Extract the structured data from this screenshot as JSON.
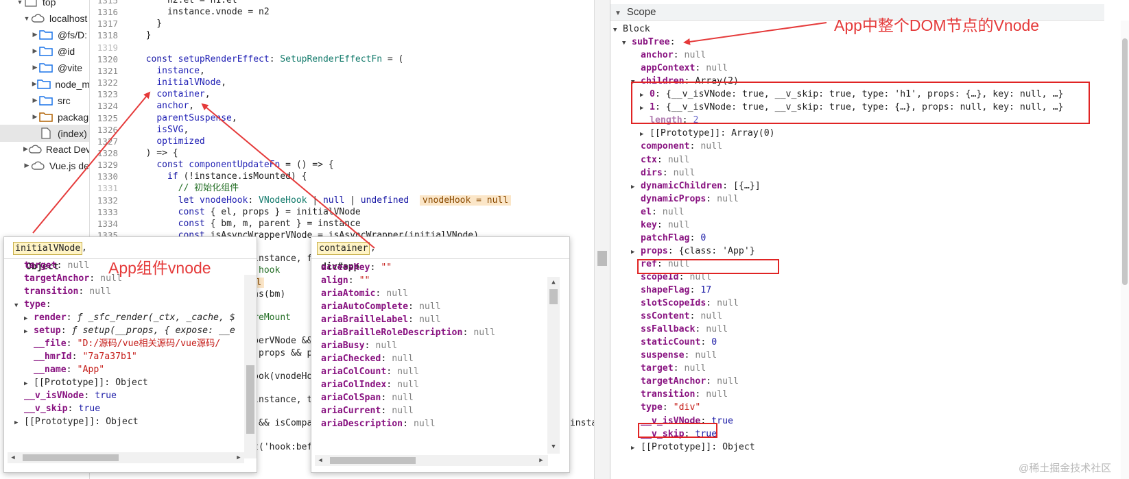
{
  "file_tree": {
    "items": [
      {
        "label": "top",
        "icon": "frame-icon",
        "arrow": "▼",
        "indent": 0
      },
      {
        "label": "localhost",
        "icon": "cloud-icon",
        "arrow": "▼",
        "indent": 1
      },
      {
        "label": "@fs/D:",
        "icon": "folder-icon",
        "arrow": "▶",
        "indent": 2
      },
      {
        "label": "@id",
        "icon": "folder-icon",
        "arrow": "▶",
        "indent": 2
      },
      {
        "label": "@vite",
        "icon": "folder-icon",
        "arrow": "▶",
        "indent": 2
      },
      {
        "label": "node_m",
        "icon": "folder-icon",
        "arrow": "▶",
        "indent": 2
      },
      {
        "label": "src",
        "icon": "folder-icon",
        "arrow": "▶",
        "indent": 2
      },
      {
        "label": "packag",
        "icon": "folder-orange-icon",
        "arrow": "▶",
        "indent": 2
      },
      {
        "label": "(index)",
        "icon": "file-icon",
        "arrow": "",
        "indent": 2
      },
      {
        "label": "React Dev",
        "icon": "cloud-icon",
        "arrow": "▶",
        "indent": 1
      },
      {
        "label": "Vue.js de",
        "icon": "cloud-icon",
        "arrow": "▶",
        "indent": 1
      }
    ]
  },
  "editor": {
    "lines": [
      {
        "n": "1315",
        "html": "      n2.el = n1.el"
      },
      {
        "n": "1316",
        "html": "      instance.vnode = n2"
      },
      {
        "n": "1317",
        "html": "    }"
      },
      {
        "n": "1318",
        "html": "  }"
      },
      {
        "n": "1319",
        "html": ""
      },
      {
        "n": "1320",
        "html": "  <span class='kw'>const</span> <span class='id'>setupRenderEffect</span>: <span class='ty'>SetupRenderEffectFn</span> = ("
      },
      {
        "n": "1321",
        "html": "    <span class='id'>instance</span>,"
      },
      {
        "n": "1322",
        "html": "    <span class='id'>initialVNode</span>,"
      },
      {
        "n": "1323",
        "html": "    <span class='id'>container</span>,"
      },
      {
        "n": "1324",
        "html": "    <span class='id'>anchor</span>,"
      },
      {
        "n": "1325",
        "html": "    <span class='id'>parentSuspense</span>,"
      },
      {
        "n": "1326",
        "html": "    <span class='id'>isSVG</span>,"
      },
      {
        "n": "1327",
        "html": "    <span class='id'>optimized</span>"
      },
      {
        "n": "1328",
        "html": "  ) => {"
      },
      {
        "n": "1329",
        "html": "    <span class='kw'>const</span> <span class='id'>componentUpdateFn</span> = () => {"
      },
      {
        "n": "1330",
        "html": "      <span class='kw'>if</span> (!instance.isMounted) {"
      },
      {
        "n": "1331",
        "html": "        <span class='cm'>// 初始化组件</span>"
      },
      {
        "n": "1332",
        "html": "        <span class='kw'>let</span> <span class='id'>vnodeHook</span>: <span class='ty'>VNodeHook</span> | <span class='kw'>null</span> | <span class='kw'>undefined</span>  <span class='hl'>vnodeHook = null</span>"
      },
      {
        "n": "1333",
        "html": "        <span class='kw'>const</span> { el, props } = initialVNode"
      },
      {
        "n": "1334",
        "html": "        <span class='kw'>const</span> { bm, m, parent } = instance"
      },
      {
        "n": "1335",
        "html": "        <span class='kw'>const</span> isAsyncWrapperVNode = isAsyncWrapper(initialVNode)"
      },
      {
        "n": "1336",
        "html": ""
      },
      {
        "n": "1337",
        "html": "        toggleRecurse(instance, false)"
      },
      {
        "n": "1338",
        "html": "        <span class='cm'>// beforeMount hook</span>"
      },
      {
        "n": "1339",
        "html": "        <span class='kw'>if</span> (bm) {  <span class='hl'>null</span>"
      },
      {
        "n": "1340",
        "html": "          invokeArrayFns(bm)"
      },
      {
        "n": "1341",
        "html": "        }"
      },
      {
        "n": "1342",
        "html": "        <span class='cm'>// onVnodeBeforeMount</span>"
      },
      {
        "n": "1343",
        "html": "        <span class='kw'>if</span> ("
      },
      {
        "n": "1344",
        "html": "          !isAsyncWrapperVNode &&"
      },
      {
        "n": "1345",
        "html": "          (vnodeHook = props && props.onVnodeBeforeMount)  <span class='hl'>props</span>"
      },
      {
        "n": "1346",
        "html": "        ) {"
      },
      {
        "n": "1347",
        "html": "          invokeVNodeHook(vnodeHook, parent, initialVNode)  <span class='hl'>pare</span>"
      },
      {
        "n": "1348",
        "html": "        }"
      },
      {
        "n": "1349",
        "html": "        toggleRecurse(instance, true)"
      },
      {
        "n": "1350",
        "html": ""
      },
      {
        "n": "1351",
        "html": "        if (__COMPAT__ && isCompatEnabled(DeprecationTypes.INSTANCE_EVENT_HOOKS, instance)) {"
      },
      {
        "n": "1352",
        "html": ""
      },
      {
        "n": "1353",
        "html": "          instance.emit('hook:beforeMount')"
      }
    ]
  },
  "popup_initialvnode": {
    "token": "initialVNode",
    "title": "Object",
    "rows": [
      {
        "arrow": "",
        "indent": 0,
        "key": "target",
        "val": "null",
        "cls": "snull"
      },
      {
        "arrow": "",
        "indent": 0,
        "key": "targetAnchor",
        "val": "null",
        "cls": "snull"
      },
      {
        "arrow": "",
        "indent": 0,
        "key": "transition",
        "val": "null",
        "cls": "snull"
      },
      {
        "arrow": "▼",
        "indent": 0,
        "key": "type",
        "val": "",
        "cls": "snull"
      },
      {
        "arrow": "▶",
        "indent": 1,
        "key": "render",
        "val": "ƒ _sfc_render(_ctx, _cache, $",
        "cls": "fn"
      },
      {
        "arrow": "▶",
        "indent": 1,
        "key": "setup",
        "val": "ƒ setup(__props, { expose: __e",
        "cls": "fn"
      },
      {
        "arrow": "",
        "indent": 1,
        "key": "__file",
        "val": "\"D:/源码/vue相关源码/vue源码/",
        "cls": "sstr"
      },
      {
        "arrow": "",
        "indent": 1,
        "key": "__hmrId",
        "val": "\"7a7a37b1\"",
        "cls": "sstr"
      },
      {
        "arrow": "",
        "indent": 1,
        "key": "__name",
        "val": "\"App\"",
        "cls": "sstr"
      },
      {
        "arrow": "▶",
        "indent": 1,
        "key": "[[Prototype]]",
        "val": "Object",
        "cls": "plain",
        "plainkey": true
      },
      {
        "arrow": "",
        "indent": 0,
        "key": "__v_isVNode",
        "val": "true",
        "cls": "snum"
      },
      {
        "arrow": "",
        "indent": 0,
        "key": "__v_skip",
        "val": "true",
        "cls": "snum"
      },
      {
        "arrow": "▶",
        "indent": 0,
        "key": "[[Prototype]]",
        "val": "Object",
        "cls": "plain",
        "plainkey": true
      }
    ]
  },
  "popup_container": {
    "token": "container",
    "title": "div#app",
    "rows": [
      {
        "key": "accessKey",
        "val": "\"\"",
        "cls": "sstr"
      },
      {
        "key": "align",
        "val": "\"\"",
        "cls": "sstr"
      },
      {
        "key": "ariaAtomic",
        "val": "null",
        "cls": "snull"
      },
      {
        "key": "ariaAutoComplete",
        "val": "null",
        "cls": "snull"
      },
      {
        "key": "ariaBrailleLabel",
        "val": "null",
        "cls": "snull"
      },
      {
        "key": "ariaBrailleRoleDescription",
        "val": "null",
        "cls": "snull"
      },
      {
        "key": "ariaBusy",
        "val": "null",
        "cls": "snull"
      },
      {
        "key": "ariaChecked",
        "val": "null",
        "cls": "snull"
      },
      {
        "key": "ariaColCount",
        "val": "null",
        "cls": "snull"
      },
      {
        "key": "ariaColIndex",
        "val": "null",
        "cls": "snull"
      },
      {
        "key": "ariaColSpan",
        "val": "null",
        "cls": "snull"
      },
      {
        "key": "ariaCurrent",
        "val": "null",
        "cls": "snull"
      },
      {
        "key": "ariaDescription",
        "val": "null",
        "cls": "snull"
      }
    ]
  },
  "scope": {
    "header": "Scope",
    "rows": [
      {
        "arrow": "▼",
        "indent": 0,
        "key": "Block",
        "val": "",
        "cls": "",
        "plainkey": true
      },
      {
        "arrow": "▼",
        "indent": 1,
        "key": "subTree",
        "val": "",
        "cls": ""
      },
      {
        "arrow": "",
        "indent": 2,
        "key": "anchor",
        "val": "null",
        "cls": "snull"
      },
      {
        "arrow": "",
        "indent": 2,
        "key": "appContext",
        "val": "null",
        "cls": "snull"
      },
      {
        "arrow": "▼",
        "indent": 2,
        "key": "children",
        "val": "Array(2)",
        "cls": "plain"
      },
      {
        "arrow": "▶",
        "indent": 3,
        "key": "0",
        "val": "{__v_isVNode: true, __v_skip: true, type: 'h1', props: {…}, key: null, …}",
        "cls": "plain"
      },
      {
        "arrow": "▶",
        "indent": 3,
        "key": "1",
        "val": "{__v_isVNode: true, __v_skip: true, type: {…}, props: null, key: null, …}",
        "cls": "plain"
      },
      {
        "arrow": "",
        "indent": 3,
        "key": "length",
        "val": "2",
        "cls": "snum",
        "dim": true
      },
      {
        "arrow": "▶",
        "indent": 3,
        "key": "[[Prototype]]",
        "val": "Array(0)",
        "cls": "plain",
        "plainkey": true
      },
      {
        "arrow": "",
        "indent": 2,
        "key": "component",
        "val": "null",
        "cls": "snull"
      },
      {
        "arrow": "",
        "indent": 2,
        "key": "ctx",
        "val": "null",
        "cls": "snull"
      },
      {
        "arrow": "",
        "indent": 2,
        "key": "dirs",
        "val": "null",
        "cls": "snull"
      },
      {
        "arrow": "▶",
        "indent": 2,
        "key": "dynamicChildren",
        "val": "[{…}]",
        "cls": "plain"
      },
      {
        "arrow": "",
        "indent": 2,
        "key": "dynamicProps",
        "val": "null",
        "cls": "snull"
      },
      {
        "arrow": "",
        "indent": 2,
        "key": "el",
        "val": "null",
        "cls": "snull"
      },
      {
        "arrow": "",
        "indent": 2,
        "key": "key",
        "val": "null",
        "cls": "snull"
      },
      {
        "arrow": "",
        "indent": 2,
        "key": "patchFlag",
        "val": "0",
        "cls": "snum"
      },
      {
        "arrow": "▶",
        "indent": 2,
        "key": "props",
        "val": "{class: 'App'}",
        "cls": "plain"
      },
      {
        "arrow": "",
        "indent": 2,
        "key": "ref",
        "val": "null",
        "cls": "snull"
      },
      {
        "arrow": "",
        "indent": 2,
        "key": "scopeId",
        "val": "null",
        "cls": "snull"
      },
      {
        "arrow": "",
        "indent": 2,
        "key": "shapeFlag",
        "val": "17",
        "cls": "snum"
      },
      {
        "arrow": "",
        "indent": 2,
        "key": "slotScopeIds",
        "val": "null",
        "cls": "snull"
      },
      {
        "arrow": "",
        "indent": 2,
        "key": "ssContent",
        "val": "null",
        "cls": "snull"
      },
      {
        "arrow": "",
        "indent": 2,
        "key": "ssFallback",
        "val": "null",
        "cls": "snull"
      },
      {
        "arrow": "",
        "indent": 2,
        "key": "staticCount",
        "val": "0",
        "cls": "snum"
      },
      {
        "arrow": "",
        "indent": 2,
        "key": "suspense",
        "val": "null",
        "cls": "snull"
      },
      {
        "arrow": "",
        "indent": 2,
        "key": "target",
        "val": "null",
        "cls": "snull"
      },
      {
        "arrow": "",
        "indent": 2,
        "key": "targetAnchor",
        "val": "null",
        "cls": "snull"
      },
      {
        "arrow": "",
        "indent": 2,
        "key": "transition",
        "val": "null",
        "cls": "snull"
      },
      {
        "arrow": "",
        "indent": 2,
        "key": "type",
        "val": "\"div\"",
        "cls": "sstr"
      },
      {
        "arrow": "",
        "indent": 2,
        "key": "__v_isVNode",
        "val": "true",
        "cls": "snum"
      },
      {
        "arrow": "",
        "indent": 2,
        "key": "__v_skip",
        "val": "true",
        "cls": "snum"
      },
      {
        "arrow": "▶",
        "indent": 2,
        "key": "[[Prototype]]",
        "val": "Object",
        "cls": "plain",
        "plainkey": true
      }
    ]
  },
  "annotations": {
    "vnode_label": "App中整个DOM节点的Vnode",
    "component_label": "App组件vnode",
    "color": "#e53a3a"
  },
  "watermark": "@稀土掘金技术社区"
}
